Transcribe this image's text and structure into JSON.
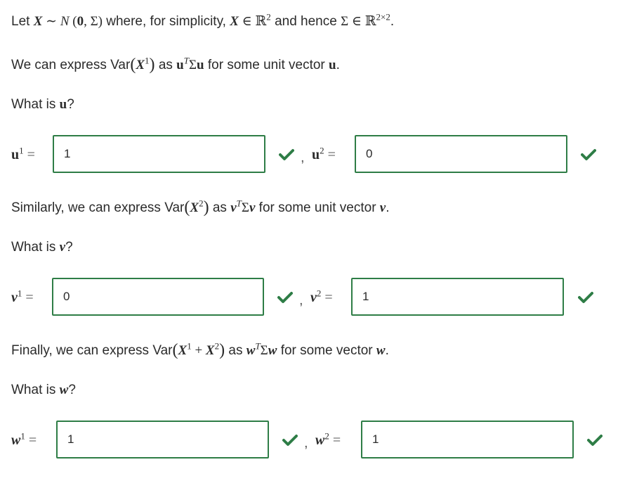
{
  "intro": {
    "let_word": "Let",
    "where_text": "where, for simplicity,",
    "and_hence_text": "and hence",
    "express_u_text": "We can express",
    "as_word": "as",
    "for_some_unit_vector": "for some unit vector",
    "period": "."
  },
  "questions": {
    "what_is": "What is",
    "q_mark": "?",
    "similarly_text": "Similarly, we can express",
    "finally_text": "Finally, we can express",
    "for_some_vector": "for some vector"
  },
  "variables": {
    "var_label": "Var",
    "u": "u",
    "v": "v",
    "w": "w"
  },
  "answers": {
    "u1": "1",
    "u2": "0",
    "v1": "0",
    "v2": "1",
    "w1": "1",
    "w2": "1"
  },
  "colors": {
    "correct_border": "#2e7d46",
    "check_green": "#2e7d46"
  },
  "icons": {
    "correct": "check-icon"
  }
}
